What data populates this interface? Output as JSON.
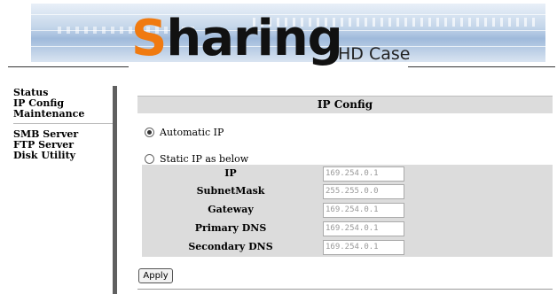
{
  "header": {
    "logo_initial": "S",
    "logo_rest": "haring",
    "subtitle": "HD Case",
    "accent_color": "#f07a10"
  },
  "sidebar": {
    "group1": [
      {
        "label": "Status"
      },
      {
        "label": "IP Config"
      },
      {
        "label": "Maintenance"
      }
    ],
    "group2": [
      {
        "label": "SMB Server"
      },
      {
        "label": "FTP Server"
      },
      {
        "label": "Disk Utility"
      }
    ]
  },
  "main": {
    "title": "IP Config",
    "automatic_label": "Automatic IP",
    "automatic_selected": true,
    "static_label": "Static IP as below",
    "static_selected": false,
    "fields": [
      {
        "label": "IP",
        "value": "169.254.0.1"
      },
      {
        "label": "SubnetMask",
        "value": "255.255.0.0"
      },
      {
        "label": "Gateway",
        "value": "169.254.0.1"
      },
      {
        "label": "Primary DNS",
        "value": "169.254.0.1"
      },
      {
        "label": "Secondary DNS",
        "value": "169.254.0.1"
      }
    ],
    "apply_label": "Apply"
  }
}
